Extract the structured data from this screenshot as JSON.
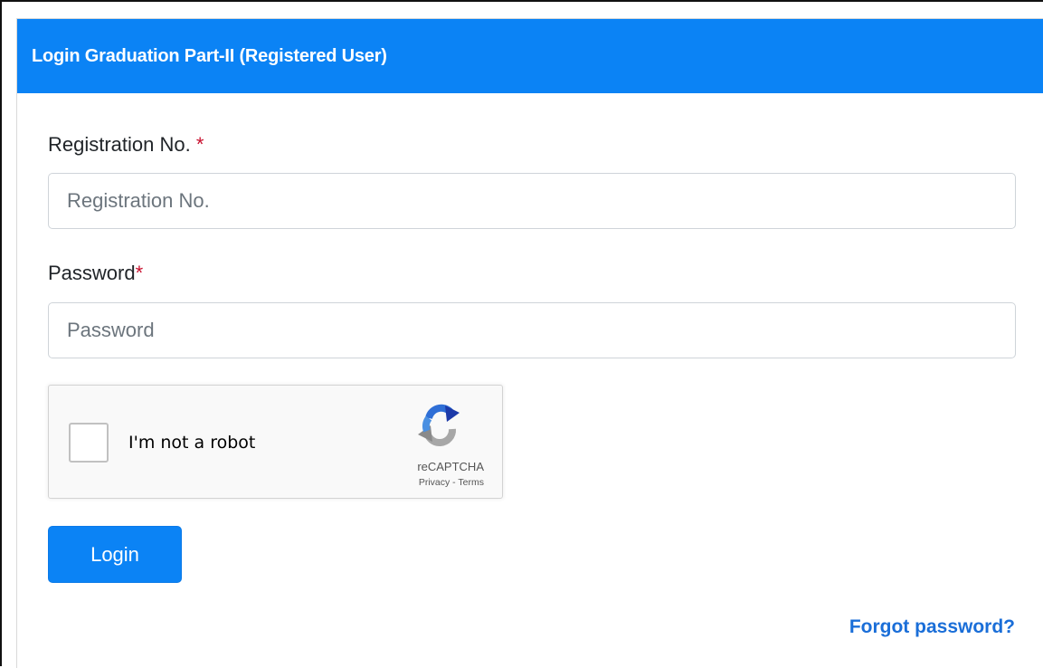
{
  "header": {
    "title": "Login Graduation Part-II (Registered User)"
  },
  "form": {
    "registration": {
      "label": "Registration No. ",
      "required_mark": "*",
      "placeholder": "Registration No.",
      "value": ""
    },
    "password": {
      "label": "Password",
      "required_mark": "*",
      "placeholder": "Password",
      "value": ""
    }
  },
  "captcha": {
    "checkbox_label": "I'm not a robot",
    "checked": false,
    "brand": "reCAPTCHA",
    "privacy_link": "Privacy",
    "separator": " - ",
    "terms_link": "Terms",
    "icon": "recaptcha-logo-icon"
  },
  "actions": {
    "login_label": "Login",
    "forgot_label": "Forgot password?"
  },
  "colors": {
    "primary": "#0b83f5",
    "required": "#c8102e",
    "link": "#1a6ed8"
  }
}
